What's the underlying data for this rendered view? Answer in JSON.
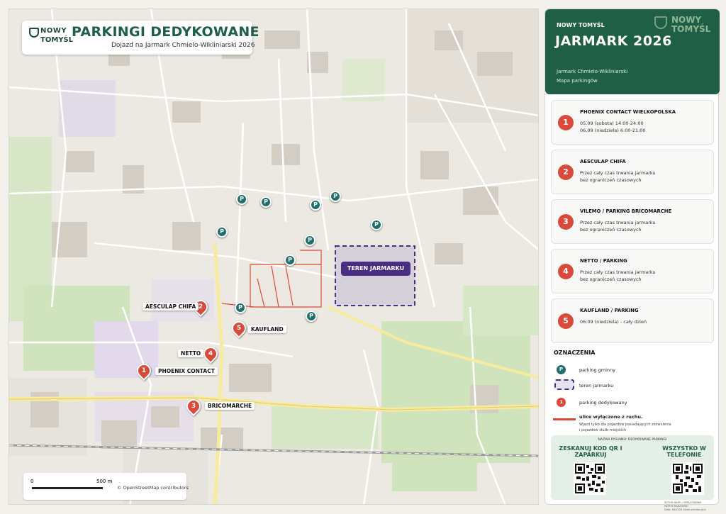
{
  "map": {
    "brand_top": "NOWY",
    "brand_bottom": "TOMYŚL",
    "title": "PARKINGI DEDYKOWANE",
    "subtitle": "Dojazd na Jarmark Chmielo-Wikliniarski 2026",
    "fair_area_label": "TEREN JARMARKU",
    "parking_symbol": "P",
    "dedicated_labels": {
      "p1": "PHOENIX CONTACT",
      "p2": "AESCULAP CHIFA",
      "p3": "BRICOMARCHE",
      "p4": "NETTO",
      "p5": "KAUFLAND"
    },
    "dedicated_numbers": [
      "1",
      "2",
      "3",
      "4",
      "5"
    ],
    "scale_zero": "0",
    "scale_max": "500 m",
    "attribution": "© OpenStreetMap contributors"
  },
  "panel": {
    "town": "NOWY TOMYŚL",
    "event": "JARMARK 2026",
    "logo_top": "NOWY",
    "logo_bottom": "TOMYŚL",
    "line1": "Jarmark Chmielo-Wikliniarski",
    "line2": "Mapa parkingów",
    "parkings": [
      {
        "num": "1",
        "name": "PHOENIX CONTACT WIELKOPOLSKA",
        "d1": "05.09 (sobota) 14:00-24:00",
        "d2": "06.09 (niedziela) 6:00-21:00"
      },
      {
        "num": "2",
        "name": "AESCULAP CHIFA",
        "d1": "Przez cały czas trwania jarmarku",
        "d2": "bez ograniczeń czasowych"
      },
      {
        "num": "3",
        "name": "VILEMO / PARKING BRICOMARCHE",
        "d1": "Przez cały czas trwania jarmarku",
        "d2": "bez ograniczeń czasowych"
      },
      {
        "num": "4",
        "name": "NETTO / PARKING",
        "d1": "Przez cały czas trwania jarmarku",
        "d2": "bez ograniczeń czasowych"
      },
      {
        "num": "5",
        "name": "KAUFLAND / PARKING",
        "d1": "06.09 (niedziela) - cały dzień",
        "d2": ""
      }
    ],
    "legend": {
      "title": "OZNACZENIA",
      "p_symbol": "P",
      "municipal": "parking gminny",
      "fair_area": "teren jarmarku",
      "dedicated_symbol": "1",
      "dedicated": "parking dedykowany",
      "closed_streets": "ulice wyłączone z ruchu.",
      "closed_note1": "Wjazd tylko dla pojazdów posiadających zezwolenia",
      "closed_note2": "i pojazdów służb miejskich"
    },
    "qr": {
      "caption": "NAZWA RYSUNKU: DEDYKOWANE PARKINGI",
      "left_heading": "ZESKANUJ KOD QR I ZAPARKUJ",
      "right_heading": "WSZYSTKO W TELEFONIE"
    },
    "footer": {
      "line1": "AUTOR MAPY / OPRACOWANIE",
      "line2": "PATRYK RAJKOWSKI",
      "line3": "Data: 06/2026  Skala orientacyjna"
    }
  },
  "colors": {
    "brand_green": "#1f5f45",
    "parking_teal": "#1f6f6b",
    "dedicated_red": "#d94a3a",
    "fair_purple": "#4b2d83"
  }
}
